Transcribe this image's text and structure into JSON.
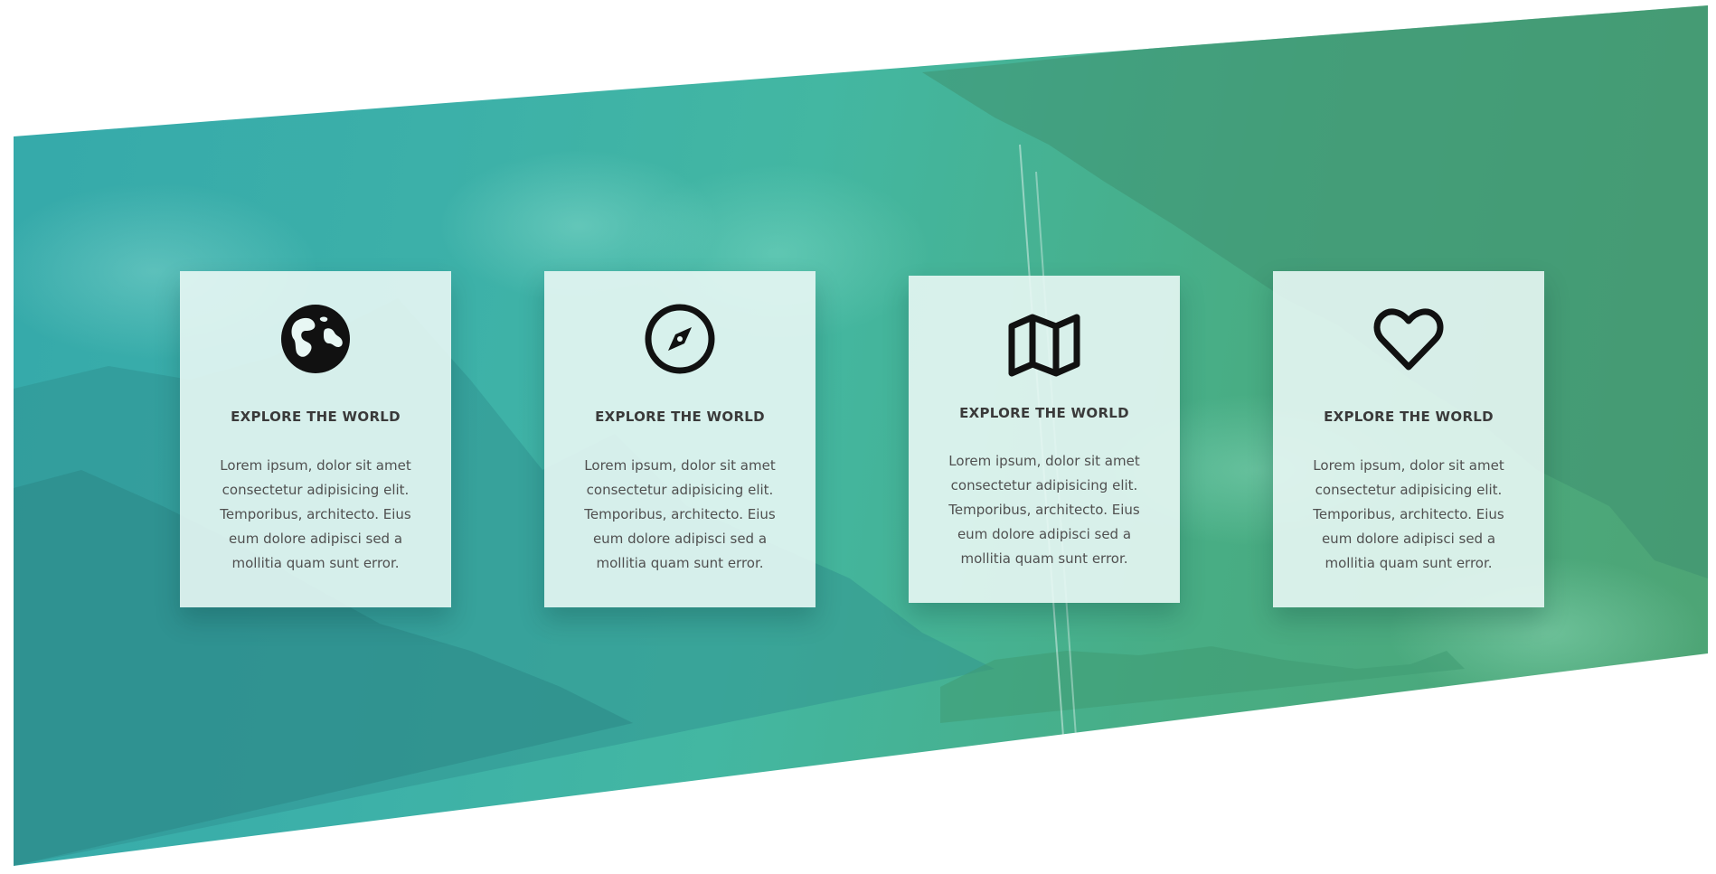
{
  "hero": {
    "accent_start": "#35a9aa",
    "accent_end": "#4ea474"
  },
  "cards": [
    {
      "icon": "globe-icon",
      "title": "EXPLORE THE WORLD",
      "body": "Lorem ipsum, dolor sit amet consectetur adipisicing elit. Temporibus, architecto. Eius eum dolore adipisci sed a mollitia quam sunt error."
    },
    {
      "icon": "compass-icon",
      "title": "EXPLORE THE WORLD",
      "body": "Lorem ipsum, dolor sit amet consectetur adipisicing elit. Temporibus, architecto. Eius eum dolore adipisci sed a mollitia quam sunt error."
    },
    {
      "icon": "map-icon",
      "title": "EXPLORE THE WORLD",
      "body": "Lorem ipsum, dolor sit amet consectetur adipisicing elit. Temporibus, architecto. Eius eum dolore adipisci sed a mollitia quam sunt error."
    },
    {
      "icon": "heart-icon",
      "title": "EXPLORE THE WORLD",
      "body": "Lorem ipsum, dolor sit amet consectetur adipisicing elit. Temporibus, architecto. Eius eum dolore adipisci sed a mollitia quam sunt error."
    }
  ]
}
